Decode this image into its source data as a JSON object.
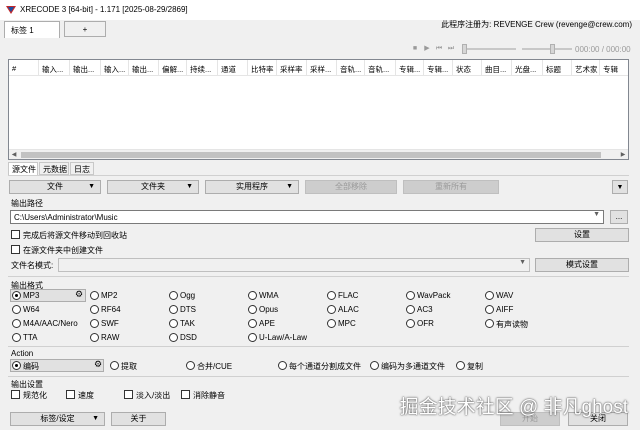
{
  "window": {
    "title": "XRECODE 3 [64-bit] - 1.171 [2025-08-29/2869]",
    "registration": "此程序注册为: REVENGE Crew (revenge@crew.com)"
  },
  "tabs": [
    "标签 1",
    "+"
  ],
  "transport": {
    "time": "000:00 / 000:00"
  },
  "columns": [
    "#",
    "输入...",
    "输出...",
    "输入...",
    "输出...",
    "偏解...",
    "持续...",
    "通道",
    "比特率",
    "采样率",
    "采样...",
    "音轨...",
    "音轨...",
    "专辑...",
    "专辑...",
    "状态",
    "曲目...",
    "光盘...",
    "标题",
    "艺术家",
    "专辑"
  ],
  "subtabs": [
    "源文件",
    "元数据",
    "日志"
  ],
  "toolbar": {
    "file": "文件",
    "folder": "文件夹",
    "utilities": "实用程序",
    "remove_all": "全部移除",
    "reset_all": "重新所有"
  },
  "output": {
    "section_label": "输出路径",
    "path": "C:\\Users\\Administrator\\Music",
    "browse": "...",
    "move_to_recycle": "完成后将源文件移动到回收站",
    "create_in_source": "在源文件夹中创建文件",
    "settings": "设置",
    "filename_pattern_label": "文件名模式:",
    "pattern_settings": "模式设置"
  },
  "formats": {
    "section_label": "输出格式",
    "items": [
      "MP3",
      "MP2",
      "Ogg",
      "WMA",
      "FLAC",
      "WavPack",
      "WAV",
      "W64",
      "RF64",
      "DTS",
      "Opus",
      "ALAC",
      "AC3",
      "AIFF",
      "M4A/AAC/Nero",
      "SWF",
      "TAK",
      "APE",
      "MPC",
      "OFR",
      "有声读物",
      "TTA",
      "RAW",
      "DSD",
      "U-Law/A-Law"
    ],
    "selected": "MP3"
  },
  "action": {
    "section_label": "Action",
    "items": [
      "编码",
      "提取",
      "合并/CUE",
      "每个通道分割成文件",
      "编码为多通道文件",
      "复制"
    ],
    "selected": "编码"
  },
  "output_settings": {
    "section_label": "输出设置",
    "items": [
      "规范化",
      "速度",
      "淡入/淡出",
      "消除静音"
    ]
  },
  "bottom": {
    "tags_settings": "标签/设定",
    "about": "关于",
    "start": "开始",
    "close": "关闭"
  },
  "watermark": "掘金技术社区 @ 非凡ghost"
}
